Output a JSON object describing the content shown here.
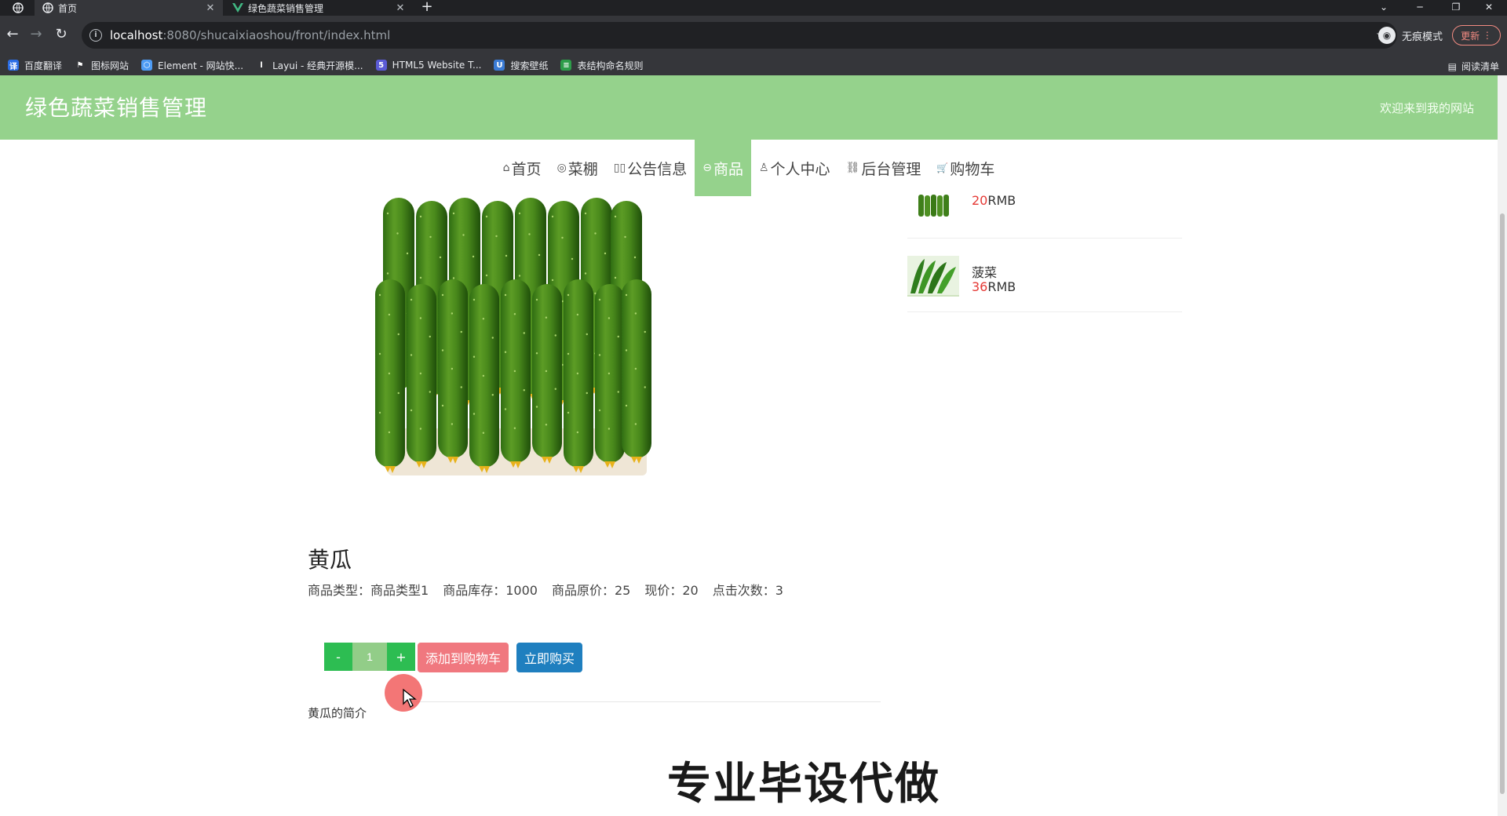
{
  "browser": {
    "tabs": [
      {
        "label": "首页",
        "active": true
      },
      {
        "label": "绿色蔬菜销售管理",
        "active": false
      }
    ],
    "url_host": "localhost",
    "url_path": ":8080/shucaixiaoshou/front/index.html",
    "profile_label": "无痕模式",
    "update_label": "更新",
    "reading_list_label": "阅读清单",
    "bookmarks": [
      {
        "label": "百度翻译",
        "icon": "translate-icon",
        "color": "#2b6de5"
      },
      {
        "label": "图标网站",
        "icon": "flag-icon",
        "color": "#35363a"
      },
      {
        "label": "Element - 网站快...",
        "icon": "element-icon",
        "color": "#4e9cf5"
      },
      {
        "label": "Layui - 经典开源模...",
        "icon": "layui-icon",
        "color": "#35363a"
      },
      {
        "label": "HTML5 Website T...",
        "icon": "html5-icon",
        "color": "#5b5bd6"
      },
      {
        "label": "搜索壁纸",
        "icon": "wallpaper-icon",
        "color": "#3a7bd5"
      },
      {
        "label": "表结构命名规则",
        "icon": "doc-icon",
        "color": "#2e9d4a"
      }
    ]
  },
  "site": {
    "title": "绿色蔬菜销售管理",
    "welcome": "欢迎来到我的网站"
  },
  "nav": [
    {
      "label": "首页",
      "icon": "home-icon",
      "glyph": "⌂",
      "active": false
    },
    {
      "label": "菜棚",
      "icon": "shed-icon",
      "glyph": "◎",
      "active": false
    },
    {
      "label": "公告信息",
      "icon": "notice-icon",
      "glyph": "▯▯",
      "active": false
    },
    {
      "label": "商品",
      "icon": "goods-icon",
      "glyph": "⊖",
      "active": true
    },
    {
      "label": "个人中心",
      "icon": "user-icon",
      "glyph": "♙",
      "active": false
    },
    {
      "label": "后台管理",
      "icon": "link-icon",
      "glyph": "⛓",
      "active": false
    },
    {
      "label": "购物车",
      "icon": "cart-icon",
      "glyph": "🛒",
      "active": false
    }
  ],
  "side_list": [
    {
      "name": "",
      "price_num": "20",
      "price_unit": "RMB"
    },
    {
      "name": "菠菜",
      "price_num": "36",
      "price_unit": "RMB"
    }
  ],
  "product": {
    "name": "黄瓜",
    "type_label": "商品类型：",
    "type_value": "商品类型1",
    "stock_label": "商品库存：",
    "stock_value": "1000",
    "orig_label": "商品原价：",
    "orig_value": "25",
    "price_label": "现价：",
    "price_value": "20",
    "clicks_label": "点击次数：",
    "clicks_value": "3",
    "description": "黄瓜的简介"
  },
  "cart": {
    "minus_label": "-",
    "plus_label": "+",
    "quantity": "1",
    "add_label": "添加到购物车",
    "buy_label": "立即购买"
  },
  "watermark": "专业毕设代做",
  "colors": {
    "header_green": "#95d28c",
    "qty_green": "#2dbd52",
    "cart_pink": "#f0787f",
    "buy_blue": "#1f7fbf",
    "price_red": "#e53935"
  }
}
